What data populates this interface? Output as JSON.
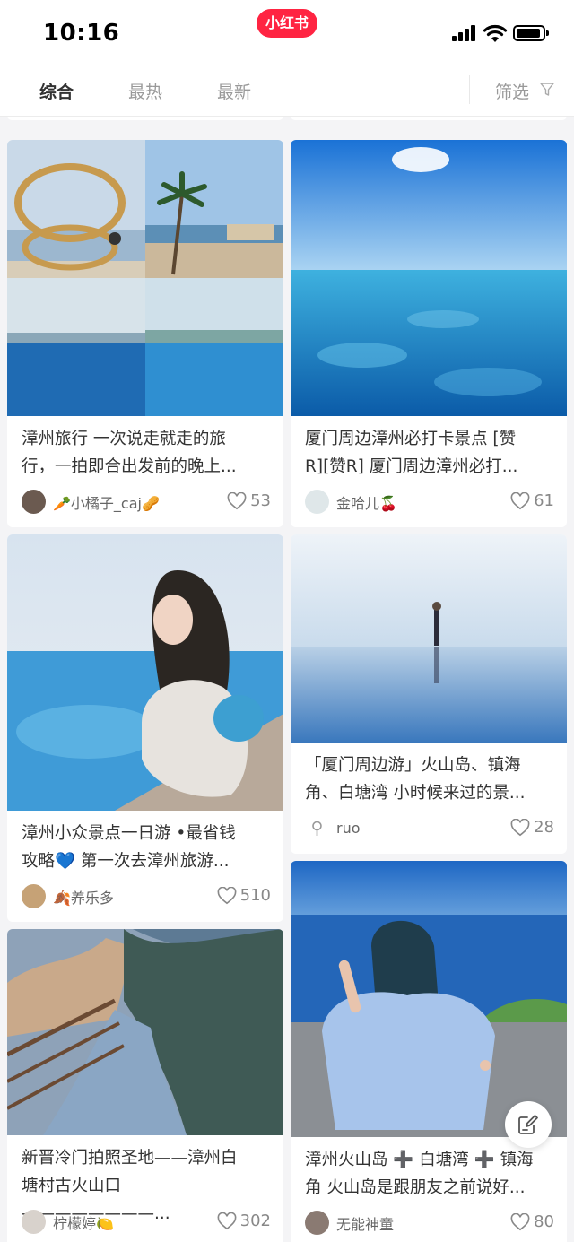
{
  "status_bar": {
    "time": "10:16",
    "app_badge": "小红书"
  },
  "tabs": [
    {
      "label": "综合",
      "active": true
    },
    {
      "label": "最热",
      "active": false
    },
    {
      "label": "最新",
      "active": false
    }
  ],
  "filter_label": "筛选",
  "filter_icon": "funnel-icon",
  "compose_icon": "edit-note-icon",
  "cards": [
    {
      "title_line1": "漳州旅行 一次说走就走的旅",
      "title_line2": "行，一拍即合出发前的晚上...",
      "author": "🥕小橘子_caj🥜",
      "likes": "53"
    },
    {
      "title_line1": "厦门周边漳州必打卡景点 [赞",
      "title_line2": "R][赞R] 厦门周边漳州必打...",
      "author": "金哈儿🍒",
      "likes": "61"
    },
    {
      "title_line1": "漳州小众景点一日游 •最省钱",
      "title_line2": "攻略💙 第一次去漳州旅游...",
      "author": "🍂养乐多",
      "likes": "510"
    },
    {
      "title_line1": "「厦门周边游」火山岛、镇海",
      "title_line2": "角、白塘湾 小时候来过的景...",
      "author": "ruo",
      "likes": "28"
    },
    {
      "title_line1": "新晋冷门拍照圣地——漳州白",
      "title_line2": "塘村古火山口————————...",
      "author": "柠檬婷🍋",
      "likes": "302"
    },
    {
      "title_line1": "漳州火山岛 ➕ 白塘湾 ➕ 镇海",
      "title_line2": "角 火山岛是跟朋友之前说好...",
      "author": "无能神童",
      "likes": "80"
    }
  ]
}
